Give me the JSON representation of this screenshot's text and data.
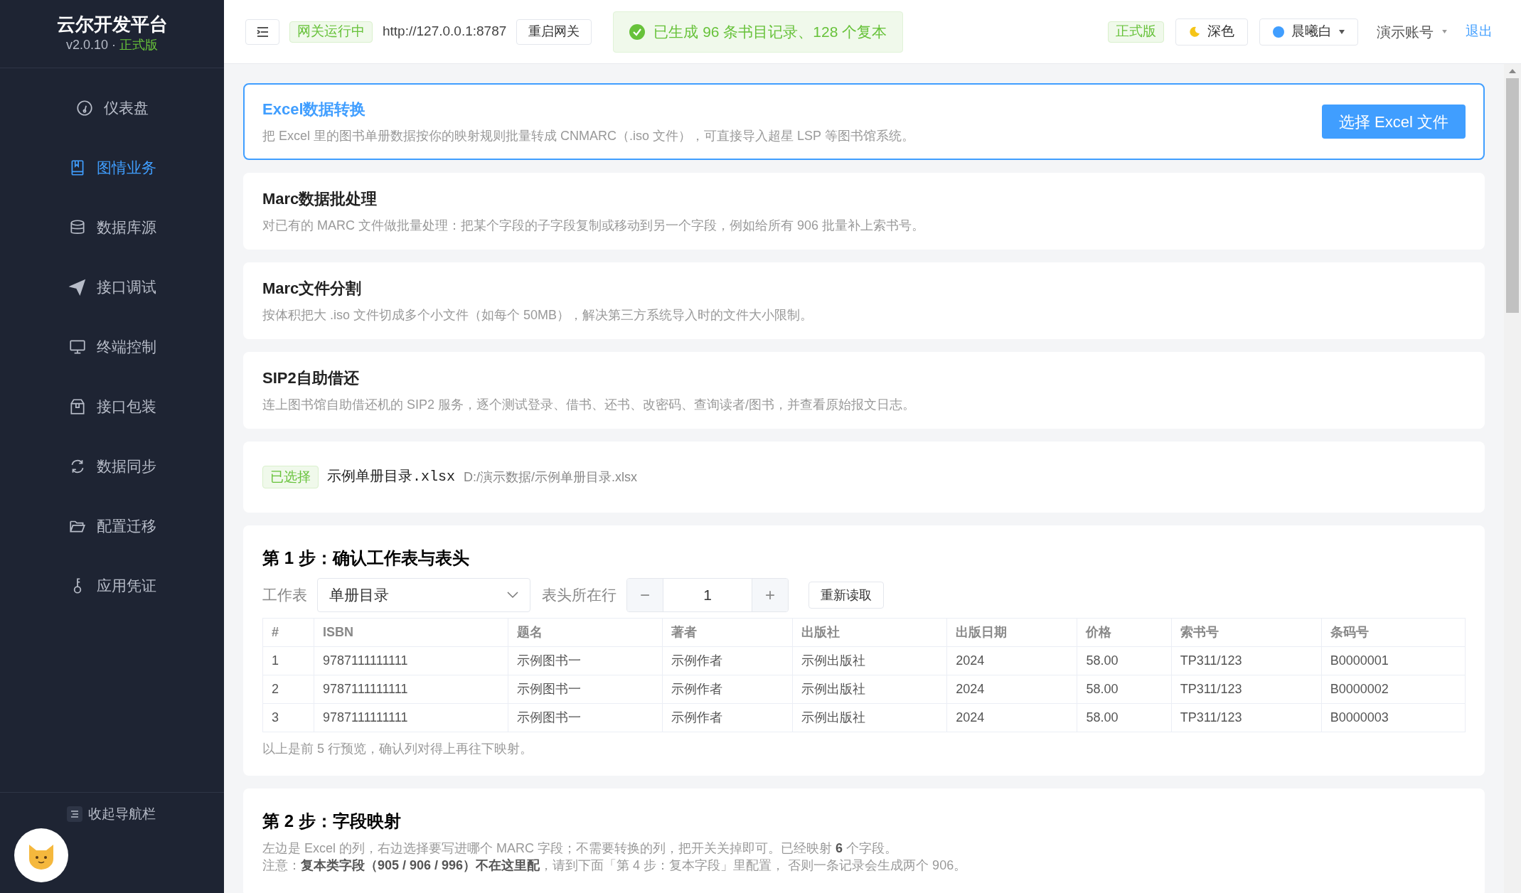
{
  "sidebar": {
    "title": "云尔开发平台",
    "version": "v2.0.10 · ",
    "edition": "正式版",
    "items": [
      {
        "label": "仪表盘",
        "selected": false
      },
      {
        "label": "图情业务",
        "selected": true
      },
      {
        "label": "数据库源",
        "selected": false
      },
      {
        "label": "接口调试",
        "selected": false
      },
      {
        "label": "终端控制",
        "selected": false
      },
      {
        "label": "接口包装",
        "selected": false
      },
      {
        "label": "数据同步",
        "selected": false
      },
      {
        "label": "配置迁移",
        "selected": false
      },
      {
        "label": "应用凭证",
        "selected": false
      }
    ],
    "collapse": "收起导航栏"
  },
  "topbar": {
    "gateway_status": "网关运行中",
    "gateway_url": "http://127.0.0.1:8787",
    "restart": "重启网关",
    "message": "已生成 96 条书目记录、128 个复本",
    "edition": "正式版",
    "dark": "深色",
    "theme": "晨曦白",
    "account": "演示账号",
    "logout": "退出"
  },
  "features": [
    {
      "title": "Excel数据转换",
      "description": "把 Excel 里的图书单册数据按你的映射规则批量转成 CNMARC（.iso 文件），可直接导入超星 LSP 等图书馆系统。",
      "selected": true,
      "action": "选择 Excel 文件"
    },
    {
      "title": "Marc数据批处理",
      "description": "对已有的 MARC 文件做批量处理：把某个字段的子字段复制或移动到另一个字段，例如给所有 906 批量补上索书号。",
      "selected": false
    },
    {
      "title": "Marc文件分割",
      "description": "按体积把大 .iso 文件切成多个小文件（如每个 50MB），解决第三方系统导入时的文件大小限制。",
      "selected": false
    },
    {
      "title": "SIP2自助借还",
      "description": "连上图书馆自助借还机的 SIP2 服务，逐个测试登录、借书、还书、改密码、查询读者/图书，并查看原始报文日志。",
      "selected": false
    }
  ],
  "file": {
    "tag": "已选择",
    "name": "示例单册目录.xlsx",
    "path": "D:/演示数据/示例单册目录.xlsx"
  },
  "step1": {
    "title": "第 1 步：确认工作表与表头",
    "sheet_label": "工作表",
    "sheet": "单册目录",
    "header_row_label": "表头所在行",
    "header_row": "1",
    "minus": "−",
    "plus": "+",
    "reload": "重新读取",
    "columns": [
      "#",
      "ISBN",
      "题名",
      "著者",
      "出版社",
      "出版日期",
      "价格",
      "索书号",
      "条码号"
    ],
    "rows": [
      [
        "1",
        "9787111111111",
        "示例图书一",
        "示例作者",
        "示例出版社",
        "2024",
        "58.00",
        "TP311/123",
        "B0000001"
      ],
      [
        "2",
        "9787111111111",
        "示例图书一",
        "示例作者",
        "示例出版社",
        "2024",
        "58.00",
        "TP311/123",
        "B0000002"
      ],
      [
        "3",
        "9787111111111",
        "示例图书一",
        "示例作者",
        "示例出版社",
        "2024",
        "58.00",
        "TP311/123",
        "B0000003"
      ]
    ],
    "note": "以上是前 5 行预览，确认列对得上再往下映射。"
  },
  "step2": {
    "title": "第 2 步：字段映射",
    "lines": [
      "左边是 Excel 的列，右边选择要写进哪个 MARC 字段；不需要转换的列，把开关关掉即可。已经映射 **6** 个字段。",
      "注意：**复本类字段（905 / 906 / 996）不在这里配**，请到下面「第 4 步：复本字段」里配置， 否则一条记录会生成两个 906。"
    ]
  }
}
